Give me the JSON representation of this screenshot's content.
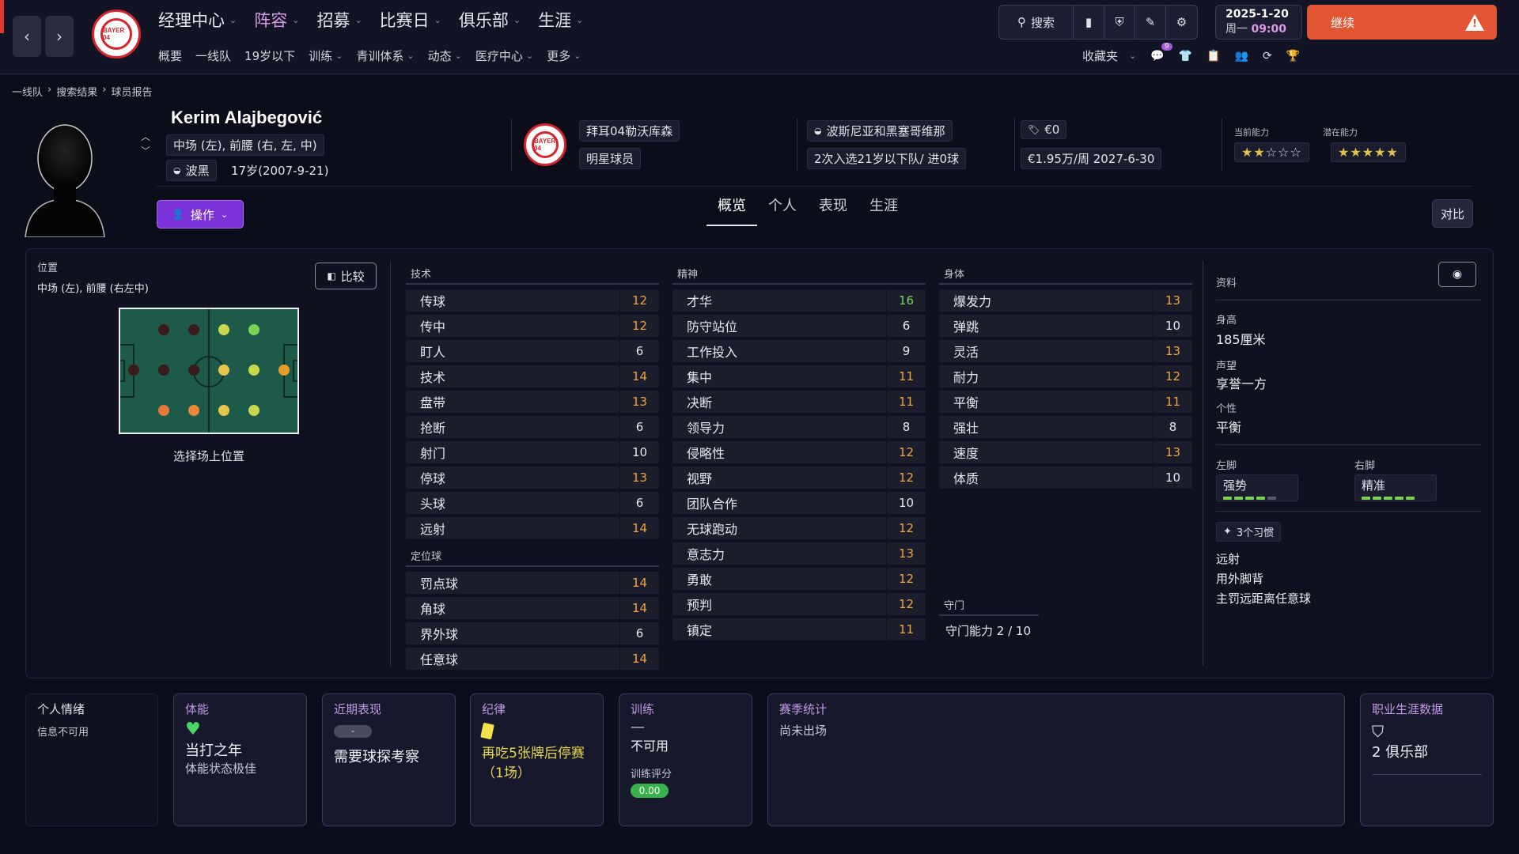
{
  "nav": {
    "main": [
      "经理中心",
      "阵容",
      "招募",
      "比赛日",
      "俱乐部",
      "生涯"
    ],
    "active_index": 1,
    "sub": [
      "概要",
      "一线队",
      "19岁以下",
      "训练",
      "青训体系",
      "动态",
      "医疗中心",
      "更多"
    ],
    "search_label": "搜索",
    "date_line1": "2025-1-20",
    "date_weekday": "周一",
    "date_time": "09:00",
    "continue_label": "继续",
    "favorites_label": "收藏夹",
    "notification_count": "9"
  },
  "breadcrumb": [
    "一线队",
    "搜索结果",
    "球员报告"
  ],
  "player": {
    "name": "Kerim Alajbegović",
    "positions": "中场 (左), 前腰 (右, 左, 中)",
    "nationality": "波黑",
    "age": "17岁(2007-9-21)",
    "club": "拜耳04勒沃库森",
    "club_crest_text": "BAYER 04",
    "status": "明星球员",
    "nation_full": "波斯尼亚和黑塞哥维那",
    "caps": "2次入选21岁以下队/ 进0球",
    "value": "€0",
    "wage_contract": "€1.95万/周  2027-6-30",
    "current_ability_label": "当前能力",
    "potential_ability_label": "潜在能力",
    "current_stars": 2,
    "potential_stars": 5
  },
  "actions": {
    "operate_label": "操作",
    "compare_label": "对比"
  },
  "tabs": [
    "概览",
    "个人",
    "表现",
    "生涯"
  ],
  "position_panel": {
    "title": "位置",
    "value": "中场 (左), 前腰 (右左中)",
    "compare_label": "比较",
    "select_label": "选择场上位置"
  },
  "technical": {
    "title": "技术",
    "items": [
      {
        "name": "传球",
        "value": 12
      },
      {
        "name": "传中",
        "value": 12
      },
      {
        "name": "盯人",
        "value": 6
      },
      {
        "name": "技术",
        "value": 14
      },
      {
        "name": "盘带",
        "value": 13
      },
      {
        "name": "抢断",
        "value": 6
      },
      {
        "name": "射门",
        "value": 10
      },
      {
        "name": "停球",
        "value": 13
      },
      {
        "name": "头球",
        "value": 6
      },
      {
        "name": "远射",
        "value": 14
      }
    ]
  },
  "set_pieces": {
    "title": "定位球",
    "items": [
      {
        "name": "罚点球",
        "value": 14
      },
      {
        "name": "角球",
        "value": 14
      },
      {
        "name": "界外球",
        "value": 6
      },
      {
        "name": "任意球",
        "value": 14
      }
    ]
  },
  "mental": {
    "title": "精神",
    "items": [
      {
        "name": "才华",
        "value": 16
      },
      {
        "name": "防守站位",
        "value": 6
      },
      {
        "name": "工作投入",
        "value": 9
      },
      {
        "name": "集中",
        "value": 11
      },
      {
        "name": "决断",
        "value": 11
      },
      {
        "name": "领导力",
        "value": 8
      },
      {
        "name": "侵略性",
        "value": 12
      },
      {
        "name": "视野",
        "value": 12
      },
      {
        "name": "团队合作",
        "value": 10
      },
      {
        "name": "无球跑动",
        "value": 12
      },
      {
        "name": "意志力",
        "value": 13
      },
      {
        "name": "勇敢",
        "value": 12
      },
      {
        "name": "预判",
        "value": 12
      },
      {
        "name": "镇定",
        "value": 11
      }
    ]
  },
  "physical": {
    "title": "身体",
    "items": [
      {
        "name": "爆发力",
        "value": 13
      },
      {
        "name": "弹跳",
        "value": 10
      },
      {
        "name": "灵活",
        "value": 13
      },
      {
        "name": "耐力",
        "value": 12
      },
      {
        "name": "平衡",
        "value": 11
      },
      {
        "name": "强壮",
        "value": 8
      },
      {
        "name": "速度",
        "value": 13
      },
      {
        "name": "体质",
        "value": 10
      }
    ]
  },
  "goalkeeping": {
    "title": "守门",
    "value": "守门能力 2 / 10"
  },
  "info": {
    "title": "资料",
    "height_label": "身高",
    "height": "185厘米",
    "reputation_label": "声望",
    "reputation": "享誉一方",
    "personality_label": "个性",
    "personality": "平衡",
    "left_foot_label": "左脚",
    "left_foot": "强势",
    "left_foot_level": 4,
    "right_foot_label": "右脚",
    "right_foot": "精准",
    "right_foot_level": 5,
    "habits_label": "3个习惯",
    "habits": [
      "远射",
      "用外脚背",
      "主罚远距离任意球"
    ]
  },
  "cards": {
    "mood": {
      "title": "个人情绪",
      "text": "信息不可用"
    },
    "fitness": {
      "title": "体能",
      "big": "当打之年",
      "small": "体能状态极佳"
    },
    "form": {
      "title": "近期表现",
      "pill": "-",
      "big": "需要球探考察"
    },
    "discipline": {
      "title": "纪律",
      "big": "再吃5张牌后停赛（1场）"
    },
    "training": {
      "title": "训练",
      "dash": "—",
      "big": "不可用",
      "rating_label": "训练评分",
      "rating": "0.00"
    },
    "season": {
      "title": "赛季统计",
      "text": "尚未出场"
    },
    "career": {
      "title": "职业生涯数据",
      "big": "2 俱乐部"
    }
  },
  "colors": {
    "accent": "#7a32d8",
    "continue": "#e25533",
    "high": "#7ad451",
    "mid": "#f0a73a"
  }
}
